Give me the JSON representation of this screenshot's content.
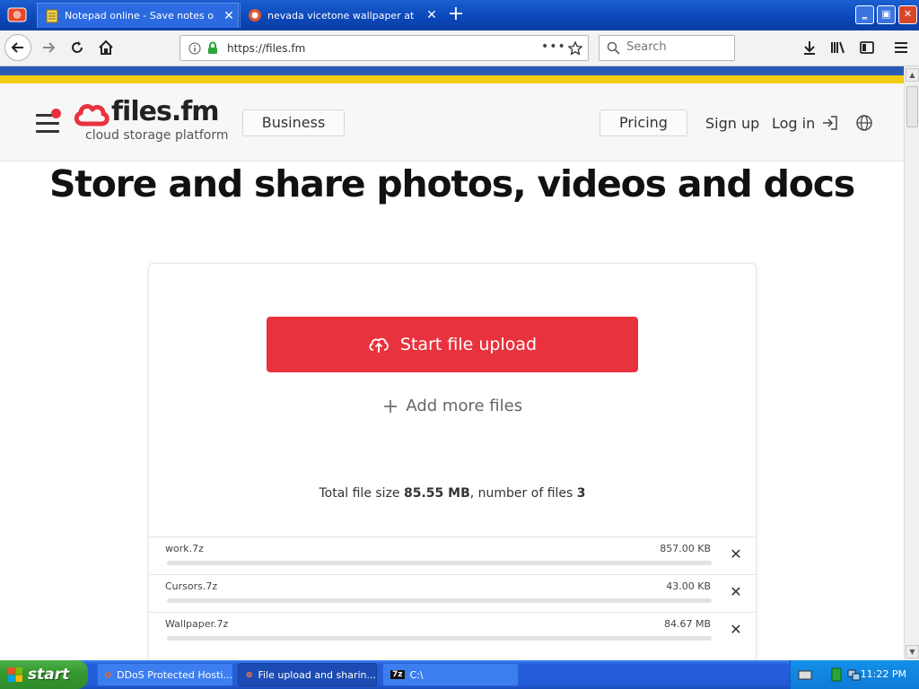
{
  "browser": {
    "tabs": [
      {
        "title": "Notepad online - Save notes online",
        "active": true
      },
      {
        "title": "nevada vicetone wallpaper at Duc",
        "active": false
      }
    ],
    "new_tab_label": "+",
    "url": "https://files.fm",
    "search_placeholder": "Search",
    "window_buttons": {
      "minimize": "‗",
      "maximize": "▣",
      "close": "✕"
    }
  },
  "site": {
    "logo_name": "files.fm",
    "logo_tagline": "cloud storage platform",
    "business_label": "Business",
    "pricing_label": "Pricing",
    "signup_label": "Sign up",
    "login_label": "Log in",
    "headline": "Store and share photos, videos and docs",
    "brand_color": "#e8323e"
  },
  "upload": {
    "start_label": "Start file upload",
    "add_more_label": "Add more files",
    "total_prefix": "Total file size",
    "total_size": "85.55 MB",
    "count_prefix": ", number of files",
    "file_count": "3",
    "files": [
      {
        "name": "work.7z",
        "size": "857.00 KB"
      },
      {
        "name": "Cursors.7z",
        "size": "43.00 KB"
      },
      {
        "name": "Wallpaper.7z",
        "size": "84.67 MB"
      }
    ]
  },
  "taskbar": {
    "start_label": "start",
    "tasks": [
      {
        "label": "DDoS Protected Hosti...",
        "active": false
      },
      {
        "label": "File upload and sharin...",
        "active": true
      },
      {
        "label": "C:\\",
        "active": false
      }
    ],
    "clock": "11:22 PM"
  }
}
